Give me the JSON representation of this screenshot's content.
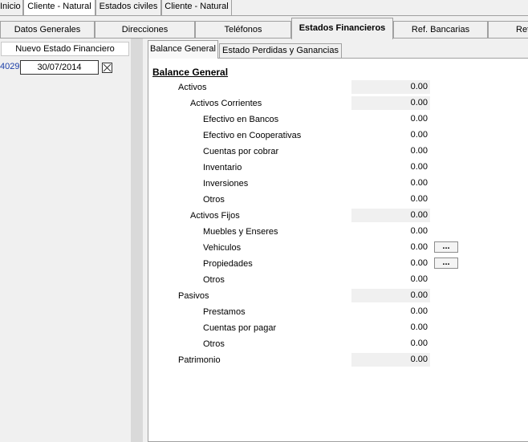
{
  "top_tabs": [
    "Inicio",
    "Cliente - Natural",
    "Estados civiles",
    "Cliente - Natural"
  ],
  "section_tabs": [
    "Datos Generales",
    "Direcciones",
    "Teléfonos",
    "Estados Financieros",
    "Ref. Bancarias",
    "Ref"
  ],
  "left": {
    "new_button": "Nuevo Estado Financiero",
    "record": {
      "id": "4029",
      "date": "30/07/2014"
    }
  },
  "inner_tabs": [
    "Balance General",
    "Estado Perdidas y Ganancias"
  ],
  "balance": {
    "title": "Balance General",
    "rows": [
      {
        "label": "Activos",
        "value": "0.00"
      },
      {
        "label": "Activos Corrientes",
        "value": "0.00"
      },
      {
        "label": "Efectivo en Bancos",
        "value": "0.00"
      },
      {
        "label": "Efectivo en Cooperativas",
        "value": "0.00"
      },
      {
        "label": "Cuentas por cobrar",
        "value": "0.00"
      },
      {
        "label": "Inventario",
        "value": "0.00"
      },
      {
        "label": "Inversiones",
        "value": "0.00"
      },
      {
        "label": "Otros",
        "value": "0.00"
      },
      {
        "label": "Activos Fijos",
        "value": "0.00"
      },
      {
        "label": "Muebles y Enseres",
        "value": "0.00"
      },
      {
        "label": "Vehiculos",
        "value": "0.00",
        "button": "..."
      },
      {
        "label": "Propiedades",
        "value": "0.00",
        "button": "..."
      },
      {
        "label": "Otros",
        "value": "0.00"
      },
      {
        "label": "Pasivos",
        "value": "0.00"
      },
      {
        "label": "Prestamos",
        "value": "0.00"
      },
      {
        "label": "Cuentas por pagar",
        "value": "0.00"
      },
      {
        "label": "Otros",
        "value": "0.00"
      },
      {
        "label": "Patrimonio",
        "value": "0.00"
      }
    ]
  }
}
